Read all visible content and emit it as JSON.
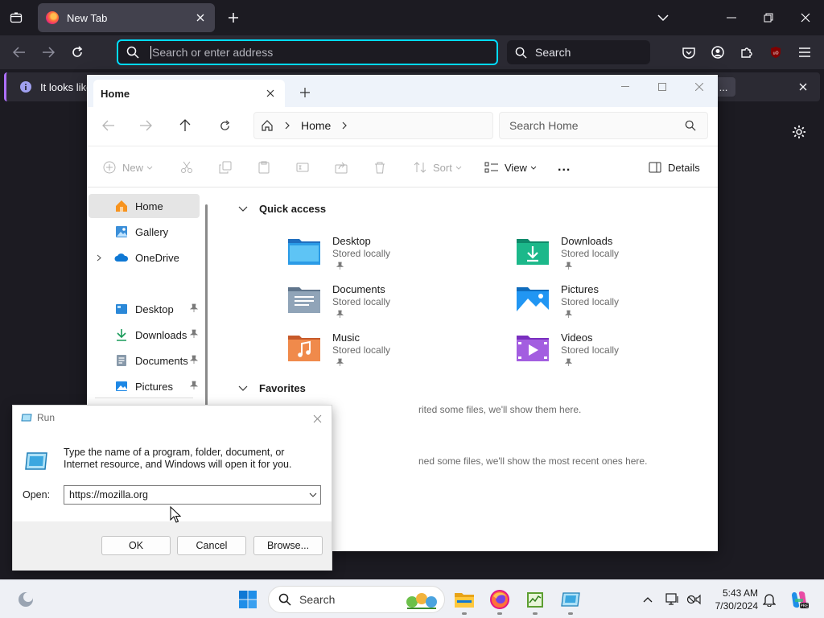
{
  "firefox": {
    "tab_title": "New Tab",
    "address_placeholder": "Search or enter address",
    "search_placeholder": "Search",
    "notification_text": "It looks like",
    "notification_button": "...",
    "accent_color": "#00ddff"
  },
  "explorer": {
    "tab_title": "Home",
    "breadcrumb": [
      "Home"
    ],
    "search_placeholder": "Search Home",
    "toolbar": {
      "new_label": "New",
      "sort_label": "Sort",
      "view_label": "View",
      "more_label": "...",
      "details_label": "Details"
    },
    "nav": [
      {
        "label": "Home",
        "icon": "home-icon",
        "selected": true
      },
      {
        "label": "Gallery",
        "icon": "gallery-icon"
      },
      {
        "label": "OneDrive",
        "icon": "onedrive-icon"
      },
      {
        "label": "Desktop",
        "icon": "desktop-icon",
        "pinned": true
      },
      {
        "label": "Downloads",
        "icon": "downloads-icon",
        "pinned": true
      },
      {
        "label": "Documents",
        "icon": "documents-icon",
        "pinned": true
      },
      {
        "label": "Pictures",
        "icon": "pictures-icon",
        "pinned": true
      }
    ],
    "quick_access_header": "Quick access",
    "quick_access": [
      {
        "name": "Desktop",
        "status": "Stored locally"
      },
      {
        "name": "Downloads",
        "status": "Stored locally"
      },
      {
        "name": "Documents",
        "status": "Stored locally"
      },
      {
        "name": "Pictures",
        "status": "Stored locally"
      },
      {
        "name": "Music",
        "status": "Stored locally"
      },
      {
        "name": "Videos",
        "status": "Stored locally"
      }
    ],
    "favorites_header": "Favorites",
    "favorites_empty": "rited some files, we'll show them here.",
    "recent_empty": "ned some files, we'll show the most recent ones here."
  },
  "run_dialog": {
    "title": "Run",
    "description": "Type the name of a program, folder, document, or Internet resource, and Windows will open it for you.",
    "open_label": "Open:",
    "open_value": "https://mozilla.org",
    "ok_label": "OK",
    "cancel_label": "Cancel",
    "browse_label": "Browse..."
  },
  "taskbar": {
    "search_label": "Search",
    "time": "5:43 AM",
    "date": "7/30/2024"
  }
}
